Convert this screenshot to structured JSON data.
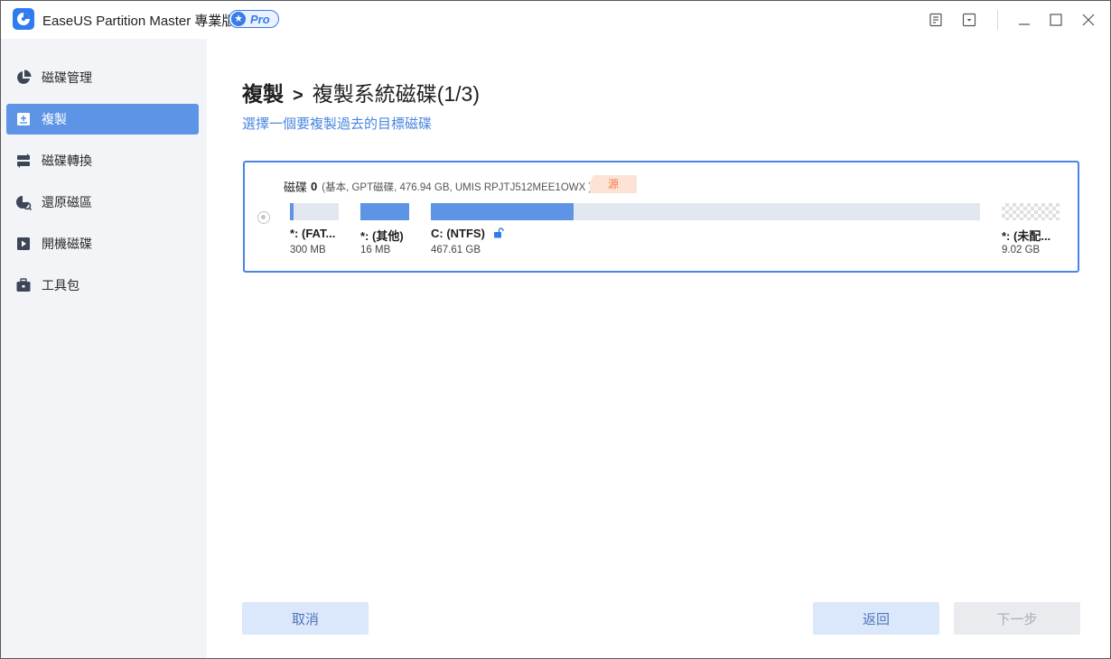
{
  "app": {
    "title": "EaseUS Partition Master 專業版",
    "badge": "Pro",
    "accent_color": "#4a86e0"
  },
  "titlebar": {
    "icons": [
      "feedback-icon",
      "menu-dropdown-icon",
      "minimize-icon",
      "maximize-icon",
      "close-icon"
    ]
  },
  "sidebar": {
    "items": [
      {
        "label": "磁碟管理",
        "icon": "pie-chart-icon",
        "active": false
      },
      {
        "label": "複製",
        "icon": "clone-icon",
        "active": true
      },
      {
        "label": "磁碟轉換",
        "icon": "convert-icon",
        "active": false
      },
      {
        "label": "還原磁區",
        "icon": "recover-icon",
        "active": false
      },
      {
        "label": "開機磁碟",
        "icon": "bootable-media-icon",
        "active": false
      },
      {
        "label": "工具包",
        "icon": "toolkit-icon",
        "active": false
      }
    ]
  },
  "main": {
    "breadcrumb_root": "複製",
    "breadcrumb_separator": ">",
    "breadcrumb_current": "複製系統磁碟(1/3)",
    "subtitle": "選擇一個要複製過去的目標磁碟"
  },
  "disk": {
    "name": "磁碟",
    "number": "0",
    "detail": "(基本, GPT磁碟, 476.94 GB, UMIS RPJTJ512MEE1OWX )",
    "source_tag": "源",
    "partitions": [
      {
        "name": "*: (FAT...",
        "size": "300 MB",
        "used_fraction": 0.08
      },
      {
        "name": "*: (其他)",
        "size": "16 MB",
        "used_fraction": 1.0
      },
      {
        "name": "C: (NTFS)",
        "size": "467.61 GB",
        "used_fraction": 0.26,
        "locked_icon": "unlock-icon"
      },
      {
        "name": "*: (未配...",
        "size": "9.02 GB",
        "unallocated": true
      }
    ]
  },
  "footer": {
    "cancel_label": "取消",
    "back_label": "返回",
    "next_label": "下一步"
  }
}
